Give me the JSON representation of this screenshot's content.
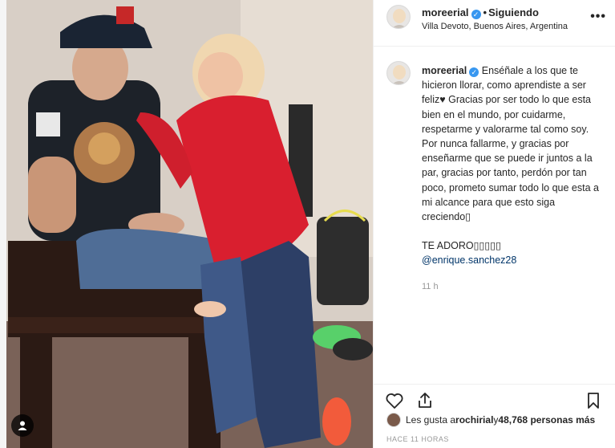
{
  "post": {
    "username": "moreerial",
    "follow_dot": "•",
    "follow_label": "Siguiendo",
    "location": "Villa Devoto, Buenos Aires, Argentina",
    "more_label": "•••",
    "verified_glyph": "✓"
  },
  "caption": {
    "username": "moreerial",
    "text": "Enséñale a los que te hicieron llorar, como aprendiste a ser feliz♥ Gracias por ser todo lo que esta bien en el mundo, por cuidarme, respetarme y valorarme tal como soy. Por nunca fallarme, y gracias por enseñarme que se puede ir juntos a la par, gracias por tanto, perdón por tan poco, prometo sumar todo lo que esta a mi alcance para que esto siga creciendo▯",
    "extra_line": "TE ADORO▯▯▯▯▯",
    "mention": "@enrique.sanchez28",
    "timestamp": "11 h"
  },
  "likes": {
    "prefix": "Les gusta a ",
    "user": "rochirial",
    "connector": " y ",
    "count": "48,768 personas más"
  },
  "time_ago": "HACE 11 HORAS",
  "icons": {
    "like": "heart-icon",
    "share": "share-icon",
    "save": "bookmark-icon",
    "more": "more-options-icon",
    "tag": "user-tag-icon"
  },
  "colors": {
    "link": "#003569",
    "verified": "#3897f0",
    "muted": "#999999",
    "text": "#262626"
  }
}
